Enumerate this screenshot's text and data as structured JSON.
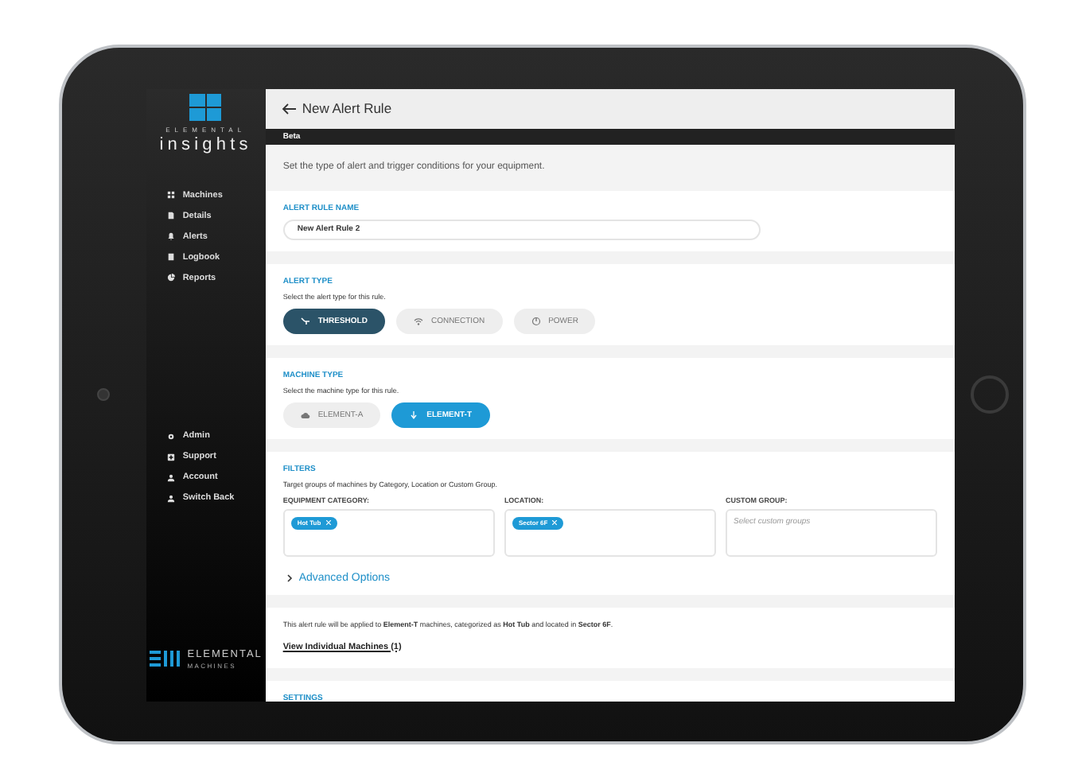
{
  "sidebar": {
    "brand_top": "ELEMENTAL",
    "brand_name": "insights",
    "nav": [
      {
        "label": "Machines",
        "kind": "grid",
        "selected": false
      },
      {
        "label": "Details",
        "kind": "doc",
        "selected": false
      },
      {
        "label": "Alerts",
        "kind": "bell",
        "selected": false
      },
      {
        "label": "Logbook",
        "kind": "book",
        "selected": false
      },
      {
        "label": "Reports",
        "kind": "pie",
        "selected": false
      }
    ],
    "secondary_nav": [
      {
        "label": "Admin",
        "kind": "gear",
        "selected": false
      },
      {
        "label": "Support",
        "kind": "plus",
        "selected": false
      },
      {
        "label": "Account",
        "kind": "person",
        "selected": false
      },
      {
        "label": "Switch Back",
        "kind": "person",
        "selected": false
      }
    ],
    "footer_brand": "ELEMENTAL",
    "footer_sub": "MACHINES"
  },
  "header": {
    "title": "New Alert Rule"
  },
  "beta_bar": "Beta",
  "intro": "Set the type of alert and trigger conditions for your equipment.",
  "alert_rule_name": {
    "label": "ALERT RULE NAME",
    "value": "New Alert Rule 2"
  },
  "alert_type": {
    "label": "ALERT TYPE",
    "hint": "Select the alert type for this rule.",
    "options": [
      {
        "label": "THRESHOLD",
        "kind": "threshold",
        "selected": true
      },
      {
        "label": "CONNECTION",
        "kind": "wifi",
        "selected": false
      },
      {
        "label": "POWER",
        "kind": "power",
        "selected": false
      }
    ]
  },
  "machine_type": {
    "label": "MACHINE TYPE",
    "hint": "Select the machine type for this rule.",
    "options": [
      {
        "label": "ELEMENT-A",
        "kind": "cloud",
        "selected": false
      },
      {
        "label": "ELEMENT-T",
        "kind": "down",
        "selected": true
      }
    ]
  },
  "filters": {
    "label": "FILTERS",
    "hint": "Target groups of machines by Category, Location or Custom Group.",
    "fields": [
      {
        "label": "EQUIPMENT CATEGORY:",
        "tags": [
          "Hot Tub"
        ]
      },
      {
        "label": "LOCATION:",
        "tags": [
          "Sector 6F"
        ]
      },
      {
        "label": "CUSTOM GROUP:",
        "placeholder": "Select custom groups"
      }
    ],
    "advanced": {
      "label": "Advanced Options",
      "expanded": false
    }
  },
  "summary": {
    "text": "This alert rule will be applied to **Element-T** machines, categorized as **Hot Tub** and located in **Sector 6F**.",
    "link": "View Individual Machines (1)"
  },
  "settings": {
    "label": "SETTINGS"
  }
}
